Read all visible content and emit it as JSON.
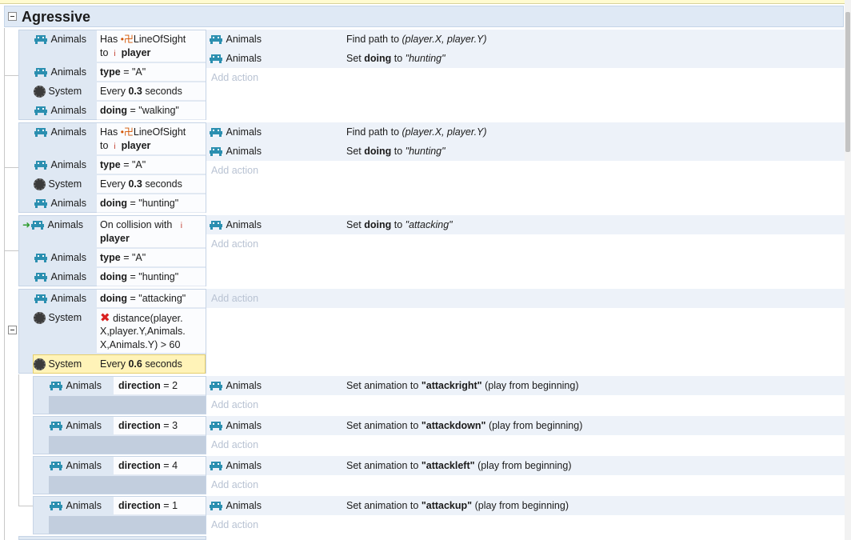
{
  "group": {
    "title": "Agressive"
  },
  "objects": {
    "animals": "Animals",
    "system": "System"
  },
  "icons": {
    "object": "space-invader-icon",
    "system": "gear-icon",
    "trigger": "green-arrow-icon",
    "invert": "red-x-icon"
  },
  "colors": {
    "accent": "#4a90c2",
    "selection": "#fff3b8",
    "add_action": "#b9c3d3"
  },
  "common": {
    "add_action": "Add action",
    "has": "Has",
    "los": "LineOfSight",
    "to": "to",
    "player": "player",
    "every": "Every",
    "seconds": "seconds",
    "set": "Set",
    "find_path": "Find path to",
    "set_anim": "Set animation to",
    "play_from": "(play from beginning)",
    "on_collision": "On collision with",
    "doing": "doing",
    "type": "type",
    "direction": "direction",
    "eq": "="
  },
  "events": [
    {
      "conditions": {
        "type_val": "\"A\"",
        "every_val": "0.3",
        "doing_val": "\"walking\""
      },
      "actions": {
        "path_args": "(player.X, player.Y)",
        "doing_val": "\"hunting\""
      }
    },
    {
      "conditions": {
        "type_val": "\"A\"",
        "every_val": "0.3",
        "doing_val": "\"hunting\""
      },
      "actions": {
        "path_args": "(player.X, player.Y)",
        "doing_val": "\"hunting\""
      }
    },
    {
      "conditions": {
        "type_val": "\"A\"",
        "doing_val": "\"hunting\""
      },
      "actions": {
        "doing_val": "\"attacking\""
      }
    },
    {
      "conditions": {
        "doing_val": "\"attacking\"",
        "distance_expr": "distance(player.X,player.Y,Animals.X,Animals.Y) > 60",
        "distance_l1": "distance(player.",
        "distance_l2": "X,player.Y,Animals.",
        "distance_l3": "X,Animals.Y) > 60",
        "every_val": "0.6"
      },
      "subevents": [
        {
          "dir": "2",
          "anim": "\"attackright\""
        },
        {
          "dir": "3",
          "anim": "\"attackdown\""
        },
        {
          "dir": "4",
          "anim": "\"attackleft\""
        },
        {
          "dir": "1",
          "anim": "\"attackup\""
        }
      ]
    }
  ]
}
